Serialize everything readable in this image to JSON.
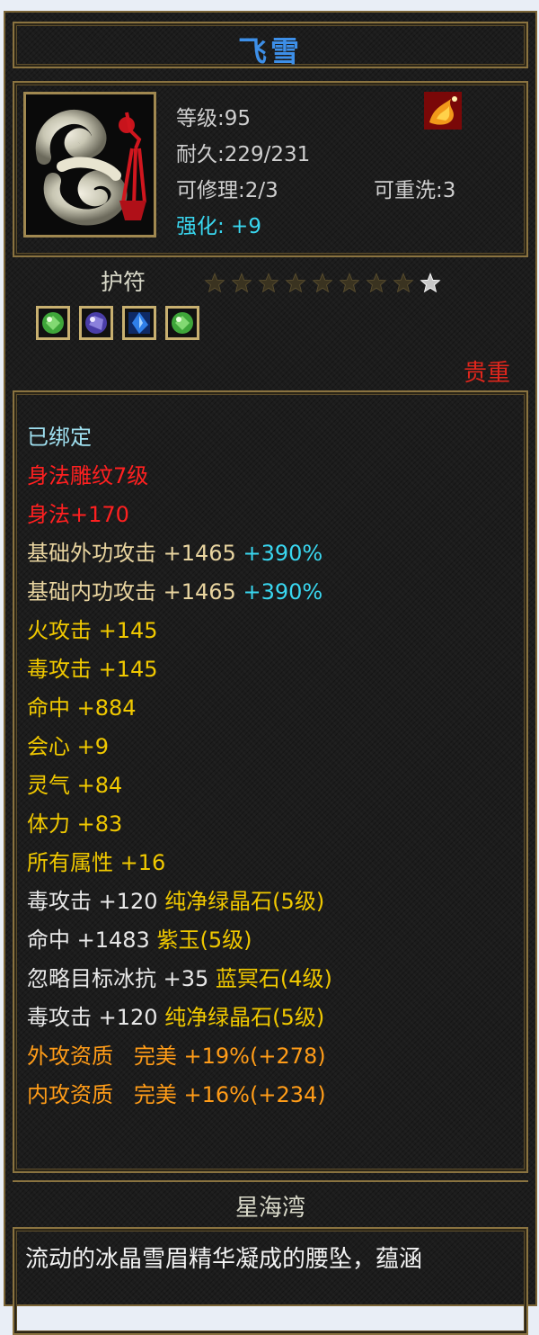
{
  "item": {
    "name": "飞雪",
    "icon": "jade-pendant-icon",
    "badge_icon": "fire-phoenix-icon"
  },
  "stats": {
    "level": "等级:95",
    "durability": "耐久:229/231",
    "repairable": "可修理:2/3",
    "rewash": "可重洗:3",
    "enhance": "强化: +9"
  },
  "slot": {
    "label": "护符",
    "stars_total": 9,
    "stars_filled": 8,
    "gems": [
      {
        "icon": "green-crystal-gem-icon"
      },
      {
        "icon": "purple-jade-gem-icon"
      },
      {
        "icon": "blue-crystal-gem-icon"
      },
      {
        "icon": "green-crystal-gem-icon"
      }
    ],
    "quality": "贵重"
  },
  "attributes": {
    "bound": "已绑定",
    "engrave": "身法雕纹7级",
    "agility": "身法+170",
    "ext_attack": {
      "label": "基础外功攻击  +1465",
      "pct": "+390%"
    },
    "int_attack": {
      "label": "基础内功攻击  +1465",
      "pct": "+390%"
    },
    "fire": "火攻击  +145",
    "poison": "毒攻击  +145",
    "hit": "命中  +884",
    "crit": "会心  +9",
    "spirit": "灵气  +84",
    "stamina": "体力  +83",
    "all_attr": "所有属性  +16",
    "gem1": {
      "stat": "毒攻击  +120",
      "gem": "纯净绿晶石(5级)"
    },
    "gem2": {
      "stat": "命中  +1483",
      "gem": "紫玉(5级)"
    },
    "gem3": {
      "stat": "忽略目标冰抗  +35",
      "gem": "蓝冥石(4级)"
    },
    "gem4": {
      "stat": "毒攻击  +120",
      "gem": "纯净绿晶石(5级)"
    },
    "apt_ext": {
      "label": "外攻资质",
      "value": "完美  +19%(+278)"
    },
    "apt_int": {
      "label": "内攻资质",
      "value": "完美  +16%(+234)"
    }
  },
  "location": "星海湾",
  "description": "流动的冰晶雪眉精华凝成的腰坠，蕴涵",
  "colors": {
    "title": "#3d8fe8",
    "border": "#8a7340",
    "quality": "#e0261c",
    "bound": "#9fe0f0",
    "red": "#ff2020",
    "tan": "#e9d5a0",
    "yellow": "#f0c800",
    "orange": "#ff9c18",
    "cyan": "#39d7f0"
  }
}
